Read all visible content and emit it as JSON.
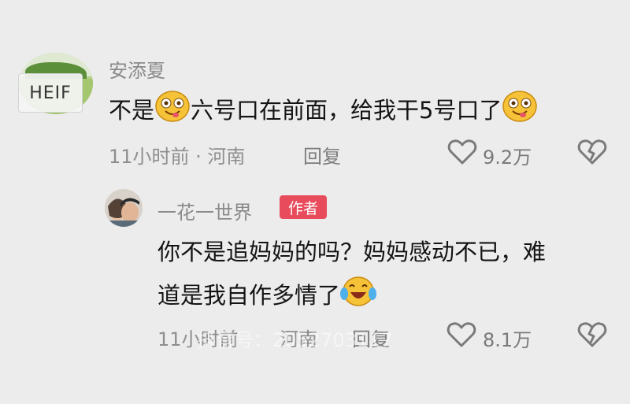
{
  "comment": {
    "username": "安添夏",
    "avatar_badge": "HEIF",
    "text_a": "不是",
    "text_b": "六号口在前面，给我干5号口了",
    "time_location": "11小时前 · 河南",
    "reply_label": "回复",
    "likes": "9.2万"
  },
  "reply": {
    "username": "一花一世界",
    "author_badge": "作者",
    "text_line1": "你不是追妈妈的吗？妈妈感动不已，难",
    "text_line2": "道是我自作多情了",
    "time": "11小时前",
    "location": "河南",
    "reply_label": "回复",
    "likes": "8.1万"
  },
  "watermark": "抖音号：2052703117",
  "colors": {
    "author_badge": "#e84b5b",
    "background": "#ececec"
  },
  "icons": [
    "heart-outline-icon",
    "broken-heart-icon",
    "smiling-emoji-icon",
    "laughing-tears-emoji-icon"
  ]
}
